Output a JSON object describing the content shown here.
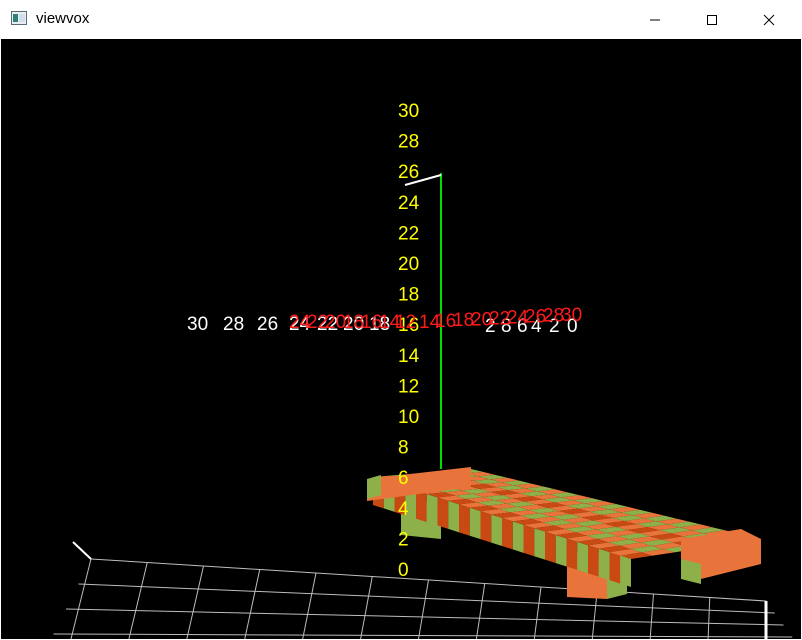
{
  "window": {
    "title": "viewvox",
    "icon": "viewvox-app-icon",
    "controls": [
      "minimize-icon",
      "maximize-icon",
      "close-icon"
    ]
  },
  "scene": {
    "background": "#000000",
    "axes": {
      "vertical": {
        "ticks": [
          "30",
          "28",
          "26",
          "24",
          "22",
          "20",
          "18",
          "16",
          "14",
          "12",
          "10",
          "8",
          "6",
          "4",
          "2",
          "0"
        ],
        "color": "#ffff00"
      },
      "horizontal_left": {
        "ticks": [
          "30",
          "28",
          "26",
          "24",
          "22",
          "20",
          "18"
        ],
        "color": "#ffffff"
      },
      "horizontal_right_white": {
        "ticks": [
          "2",
          "8",
          "6",
          "4",
          "2",
          "0"
        ],
        "color": "#ffffff"
      },
      "horizontal_red": {
        "ticks": [
          "24",
          "22",
          "20",
          "18",
          "16",
          "14",
          "12",
          "14",
          "16",
          "18",
          "20",
          "22",
          "24",
          "26",
          "28",
          "30"
        ],
        "color": "#ff1a1a"
      }
    },
    "axis_line_color": "#00dd00",
    "grid_color": "#bdbdbd",
    "voxel_colors": [
      "#e8743b",
      "#8db04a",
      "#c84a12",
      "#5a8a2a"
    ]
  }
}
